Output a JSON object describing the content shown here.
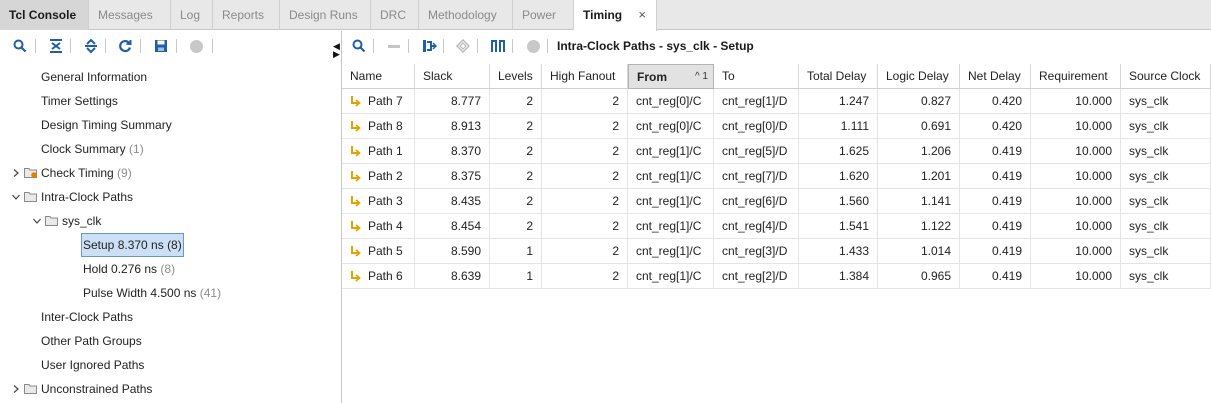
{
  "tabs": [
    {
      "label": "Tcl Console"
    },
    {
      "label": "Messages"
    },
    {
      "label": "Log"
    },
    {
      "label": "Reports"
    },
    {
      "label": "Design Runs"
    },
    {
      "label": "DRC"
    },
    {
      "label": "Methodology"
    },
    {
      "label": "Power"
    },
    {
      "label": "Timing"
    }
  ],
  "close_glyph": "×",
  "left_toolbar_icons": [
    "search-icon",
    "collapse-all-icon",
    "expand-all-icon",
    "refresh-icon",
    "save-icon",
    "status-dot-icon"
  ],
  "right_toolbar_icons": [
    "search-icon",
    "minus-icon",
    "schematic-icon",
    "clock-icon",
    "waveform-icon",
    "status-dot-icon"
  ],
  "tree": [
    {
      "label": "General Information",
      "count": ""
    },
    {
      "label": "Timer Settings",
      "count": ""
    },
    {
      "label": "Design Timing Summary",
      "count": ""
    },
    {
      "label": "Clock Summary",
      "count": "(1)"
    },
    {
      "label": "Check Timing",
      "count": "(9)"
    },
    {
      "label": "Intra-Clock Paths",
      "count": ""
    },
    {
      "label": "sys_clk",
      "count": ""
    },
    {
      "label": "Setup 8.370 ns (8)",
      "count": ""
    },
    {
      "label": "Hold 0.276 ns",
      "count": "(8)"
    },
    {
      "label": "Pulse Width 4.500 ns",
      "count": "(41)"
    },
    {
      "label": "Inter-Clock Paths",
      "count": ""
    },
    {
      "label": "Other Path Groups",
      "count": ""
    },
    {
      "label": "User Ignored Paths",
      "count": ""
    },
    {
      "label": "Unconstrained Paths",
      "count": ""
    }
  ],
  "pane_title": "Intra-Clock Paths - sys_clk - Setup",
  "sort_indicator": "^ 1",
  "columns": [
    "Name",
    "Slack",
    "Levels",
    "High Fanout",
    "From",
    "To",
    "Total Delay",
    "Logic Delay",
    "Net Delay",
    "Requirement",
    "Source Clock"
  ],
  "rows": [
    [
      "Path 7",
      "8.777",
      "2",
      "2",
      "cnt_reg[0]/C",
      "cnt_reg[1]/D",
      "1.247",
      "0.827",
      "0.420",
      "10.000",
      "sys_clk"
    ],
    [
      "Path 8",
      "8.913",
      "2",
      "2",
      "cnt_reg[0]/C",
      "cnt_reg[0]/D",
      "1.111",
      "0.691",
      "0.420",
      "10.000",
      "sys_clk"
    ],
    [
      "Path 1",
      "8.370",
      "2",
      "2",
      "cnt_reg[1]/C",
      "cnt_reg[5]/D",
      "1.625",
      "1.206",
      "0.419",
      "10.000",
      "sys_clk"
    ],
    [
      "Path 2",
      "8.375",
      "2",
      "2",
      "cnt_reg[1]/C",
      "cnt_reg[7]/D",
      "1.620",
      "1.201",
      "0.419",
      "10.000",
      "sys_clk"
    ],
    [
      "Path 3",
      "8.435",
      "2",
      "2",
      "cnt_reg[1]/C",
      "cnt_reg[6]/D",
      "1.560",
      "1.141",
      "0.419",
      "10.000",
      "sys_clk"
    ],
    [
      "Path 4",
      "8.454",
      "2",
      "2",
      "cnt_reg[1]/C",
      "cnt_reg[4]/D",
      "1.541",
      "1.122",
      "0.419",
      "10.000",
      "sys_clk"
    ],
    [
      "Path 5",
      "8.590",
      "1",
      "2",
      "cnt_reg[1]/C",
      "cnt_reg[3]/D",
      "1.433",
      "1.014",
      "0.419",
      "10.000",
      "sys_clk"
    ],
    [
      "Path 6",
      "8.639",
      "1",
      "2",
      "cnt_reg[1]/C",
      "cnt_reg[2]/D",
      "1.384",
      "0.965",
      "0.419",
      "10.000",
      "sys_clk"
    ]
  ],
  "colors": {
    "accent_blue": "#1f5fa8",
    "path_icon": "#e0a400",
    "selection": "#cce0f5"
  }
}
